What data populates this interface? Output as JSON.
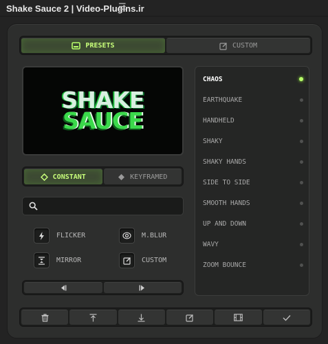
{
  "window": {
    "title": "Shake Sauce 2 | Video-Plugins.ir",
    "menu_icon": "hamburger-menu-icon"
  },
  "tabs": [
    {
      "label": "PRESETS",
      "icon": "preset-frame-icon",
      "active": true
    },
    {
      "label": "CUSTOM",
      "icon": "edit-icon",
      "active": false
    }
  ],
  "preview": {
    "logo_line1": "SHAKE",
    "logo_line2": "SAUCE"
  },
  "modes": [
    {
      "label": "CONSTANT",
      "icon": "diamond-outline-icon",
      "active": true
    },
    {
      "label": "KEYFRAMED",
      "icon": "diamond-filled-icon",
      "active": false
    }
  ],
  "search": {
    "value": "",
    "placeholder": ""
  },
  "tools": [
    {
      "label": "FLICKER",
      "icon": "lightning-icon"
    },
    {
      "label": "M.BLUR",
      "icon": "motion-blur-icon"
    },
    {
      "label": "MIRROR",
      "icon": "mirror-icon"
    },
    {
      "label": "CUSTOM",
      "icon": "edit-icon"
    }
  ],
  "nav": [
    {
      "icon": "previous-icon"
    },
    {
      "icon": "next-icon"
    }
  ],
  "presets_list": {
    "selected": "CHAOS",
    "items": [
      "CHAOS",
      "EARTHQUAKE",
      "HANDHELD",
      "SHAKY",
      "SHAKY HANDS",
      "SIDE TO SIDE",
      "SMOOTH HANDS",
      "UP AND DOWN",
      "WAVY",
      "ZOOM BOUNCE"
    ]
  },
  "bottom_actions": [
    {
      "icon": "trash-icon"
    },
    {
      "icon": "import-icon"
    },
    {
      "icon": "export-icon"
    },
    {
      "icon": "edit-icon"
    },
    {
      "icon": "film-icon"
    },
    {
      "icon": "apply-check-icon"
    }
  ],
  "colors": {
    "accent": "#b9ff6a",
    "active_bg": "#3d4a33",
    "panel": "#2d2e2d",
    "background": "#232323"
  }
}
